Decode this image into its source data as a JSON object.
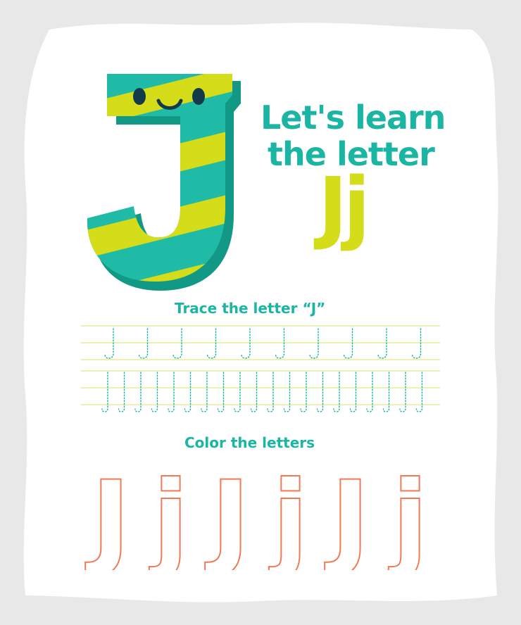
{
  "title": {
    "line1": "Let's learn",
    "line2": "the letter",
    "letters": "Jj"
  },
  "trace": {
    "heading": "Trace the letter “J”",
    "row1_glyph": "J",
    "row1_count": 10,
    "row2_glyph": "J",
    "row2_count": 20
  },
  "color": {
    "heading": "Color the letters",
    "letters": [
      "J",
      "j",
      "J",
      "j",
      "J",
      "j"
    ]
  },
  "colors": {
    "teal": "#1bb5a3",
    "yellow": "#d5dd1a",
    "outline": "#f07a55",
    "guide_line": "#e8ec9a"
  },
  "mascot": {
    "letter": "J",
    "icon": "smiling-striped-letter-j-icon"
  }
}
